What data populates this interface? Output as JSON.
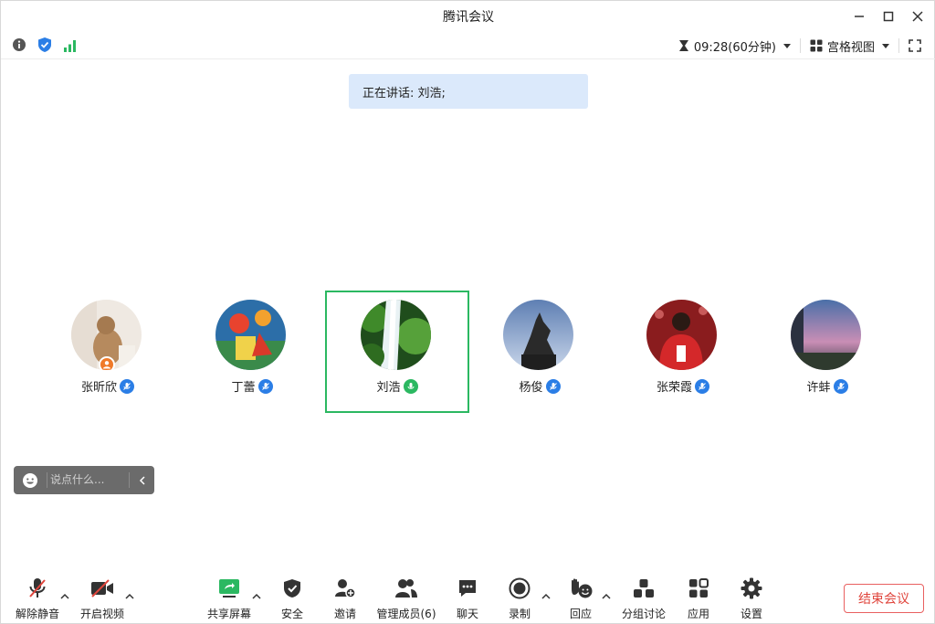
{
  "window": {
    "title": "腾讯会议"
  },
  "infobar": {
    "timer": "09:28(60分钟)",
    "view_mode": "宫格视图"
  },
  "banner": {
    "speaking_text": "正在讲话: 刘浩;"
  },
  "participants": [
    {
      "name": "张昕欣",
      "host": true,
      "mic_active": false
    },
    {
      "name": "丁蕾",
      "host": false,
      "mic_active": false
    },
    {
      "name": "刘浩",
      "host": false,
      "mic_active": true,
      "speaking": true
    },
    {
      "name": "杨俊",
      "host": false,
      "mic_active": false
    },
    {
      "name": "张荣霞",
      "host": false,
      "mic_active": false
    },
    {
      "name": "许蚌",
      "host": false,
      "mic_active": false
    }
  ],
  "chat": {
    "placeholder": "说点什么..."
  },
  "toolbar": {
    "unmute": "解除静音",
    "start_video": "开启视频",
    "share_screen": "共享屏幕",
    "security": "安全",
    "invite": "邀请",
    "manage_members": "管理成员(6)",
    "chat": "聊天",
    "record": "录制",
    "reactions": "回应",
    "breakout": "分组讨论",
    "apps": "应用",
    "settings": "设置",
    "end_meeting": "结束会议"
  },
  "colors": {
    "accent_green": "#2bb861",
    "accent_blue": "#2b7ee6",
    "end_red": "#e0453c",
    "banner_bg": "#dbe9fb"
  }
}
